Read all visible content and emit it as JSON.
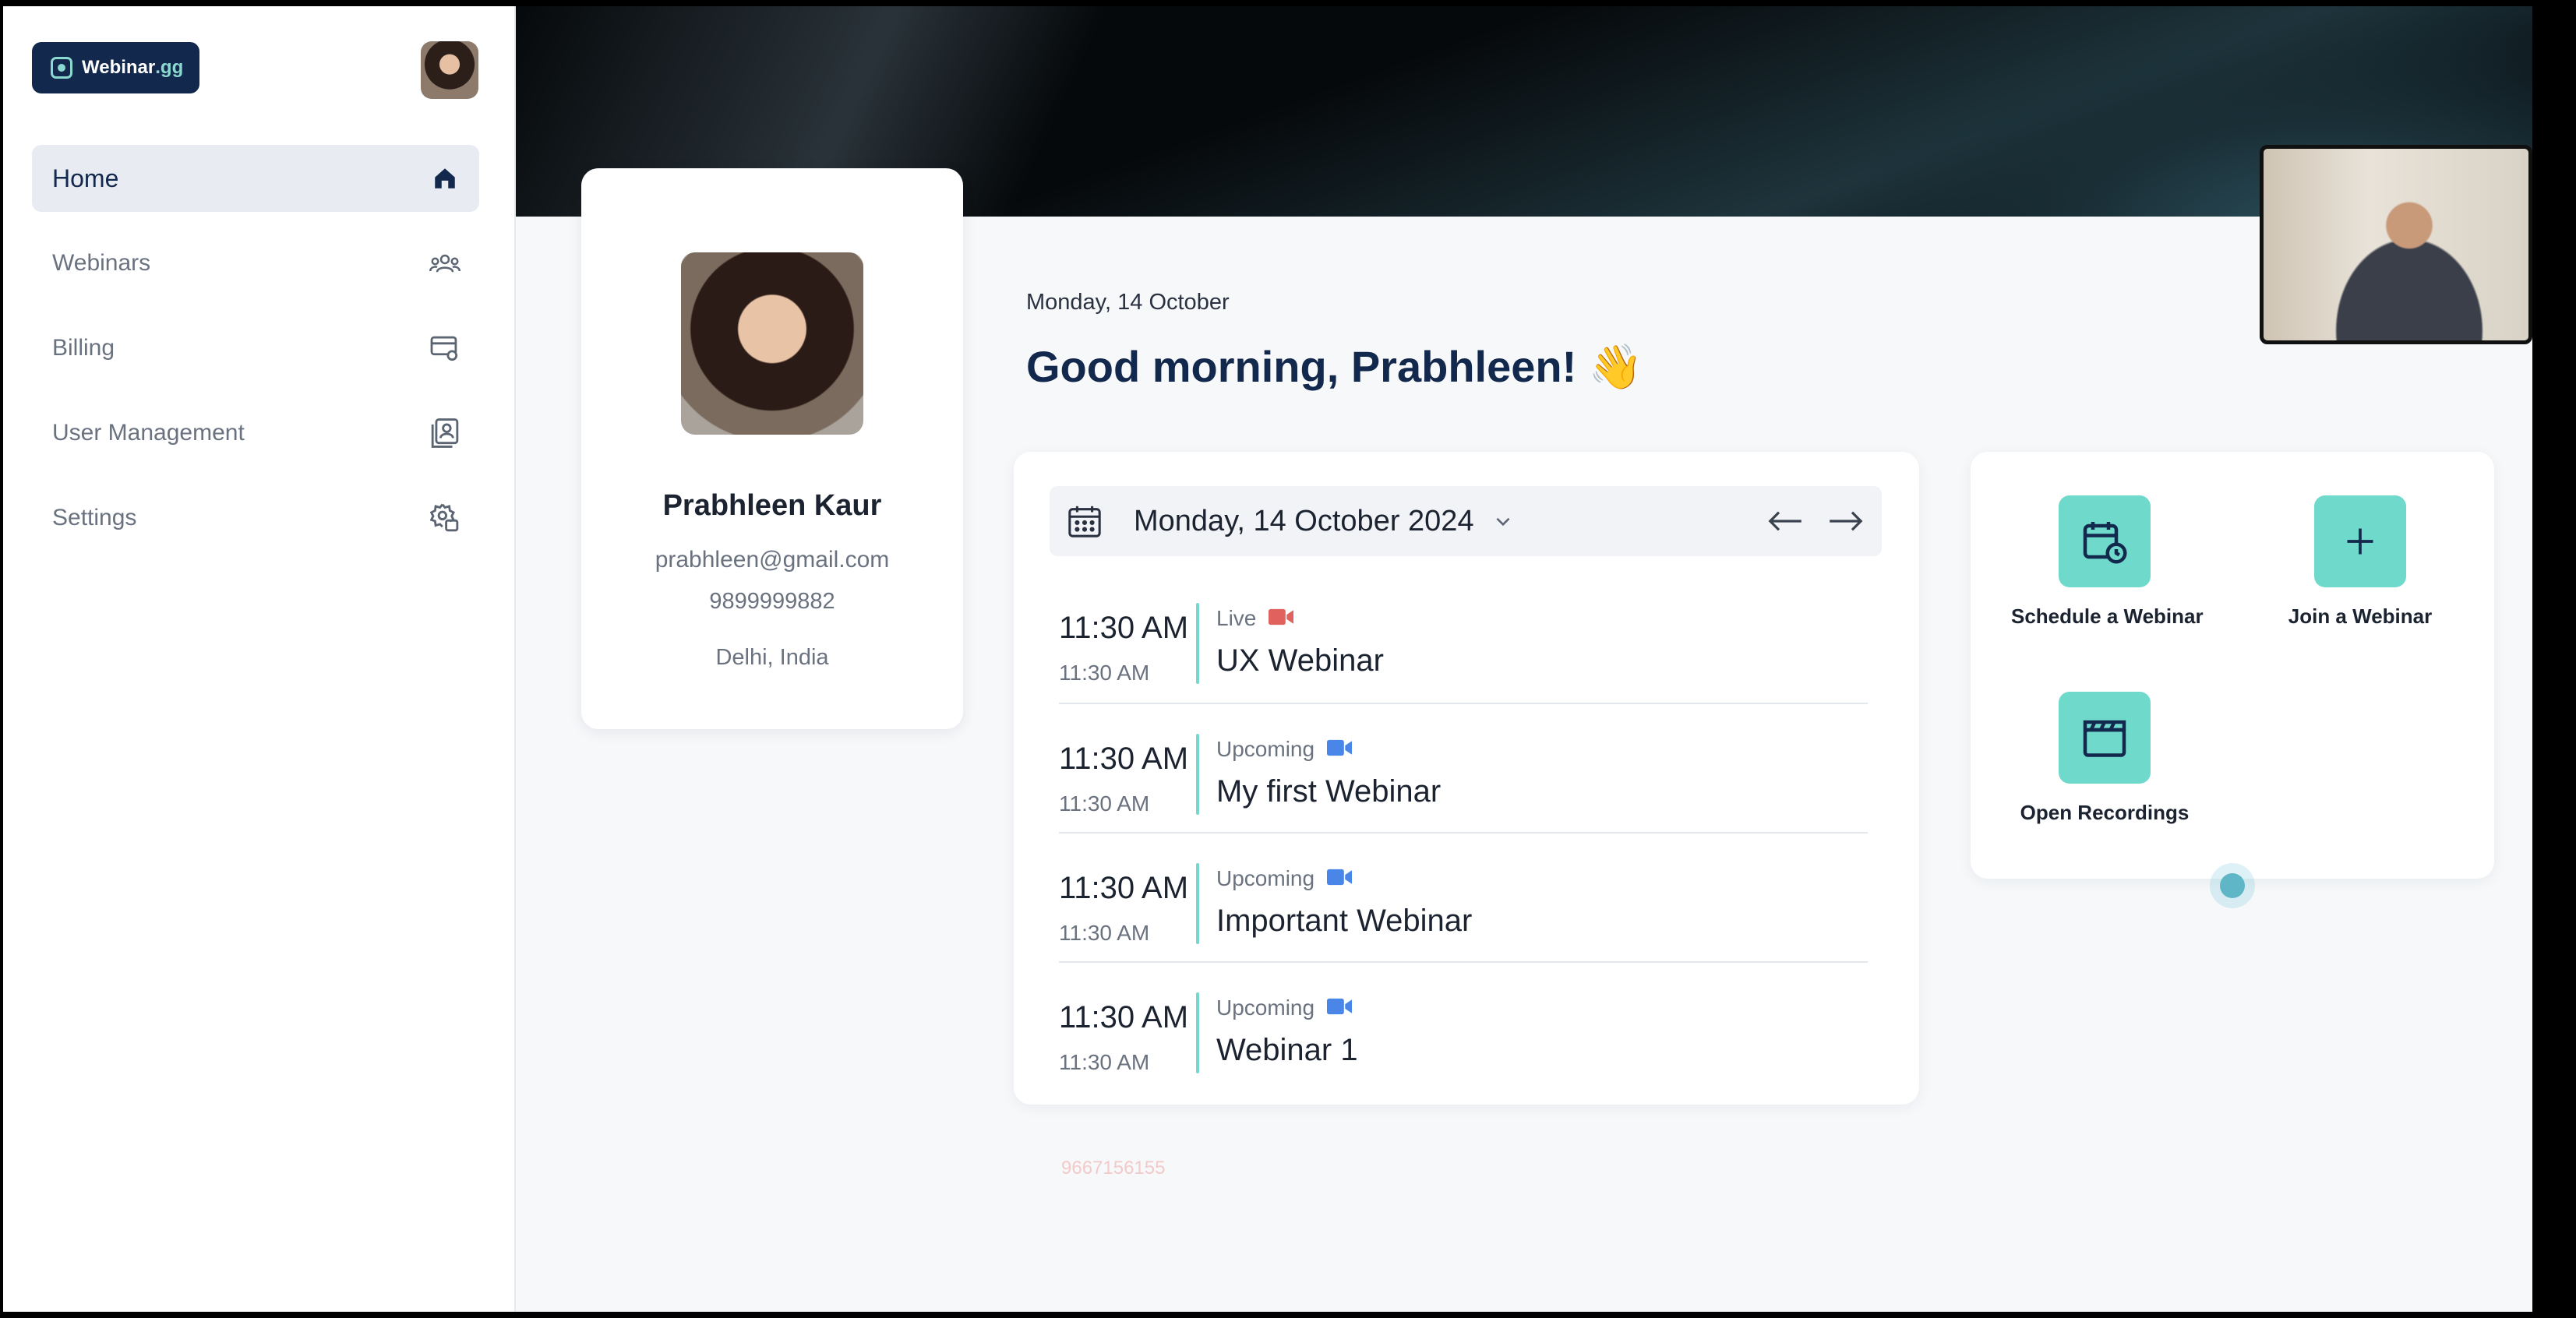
{
  "app": {
    "logo_text": "Webinar",
    "logo_suffix": ".gg"
  },
  "sidebar": {
    "items": [
      {
        "label": "Home",
        "icon": "home-icon",
        "active": true
      },
      {
        "label": "Webinars",
        "icon": "users-icon",
        "active": false
      },
      {
        "label": "Billing",
        "icon": "billing-card-icon",
        "active": false
      },
      {
        "label": "User Management",
        "icon": "user-management-icon",
        "active": false
      },
      {
        "label": "Settings",
        "icon": "settings-gear-icon",
        "active": false
      }
    ]
  },
  "profile": {
    "name": "Prabhleen Kaur",
    "email": "prabhleen@gmail.com",
    "phone": "9899999882",
    "location": "Delhi, India"
  },
  "greeting": {
    "date": "Monday, 14 October",
    "text": "Good morning, Prabhleen! 👋"
  },
  "schedule": {
    "date_label": "Monday, 14 October 2024",
    "events": [
      {
        "time": "11:30 AM",
        "sub_time": "11:30 AM",
        "status": "Live",
        "title": "UX Webinar",
        "cam_color": "#e0615e"
      },
      {
        "time": "11:30 AM",
        "sub_time": "11:30 AM",
        "status": "Upcoming",
        "title": "My first Webinar",
        "cam_color": "#4a86e8"
      },
      {
        "time": "11:30 AM",
        "sub_time": "11:30 AM",
        "status": "Upcoming",
        "title": "Important Webinar",
        "cam_color": "#4a86e8"
      },
      {
        "time": "11:30 AM",
        "sub_time": "11:30 AM",
        "status": "Upcoming",
        "title": "Webinar 1",
        "cam_color": "#4a86e8"
      }
    ]
  },
  "actions": {
    "schedule": "Schedule a Webinar",
    "join": "Join a Webinar",
    "recordings": "Open Recordings"
  },
  "watermark": "9667156155",
  "colors": {
    "brand_navy": "#13284d",
    "accent_teal": "#6fd9cb",
    "live_red": "#e0615e",
    "upcoming_blue": "#4a86e8"
  }
}
